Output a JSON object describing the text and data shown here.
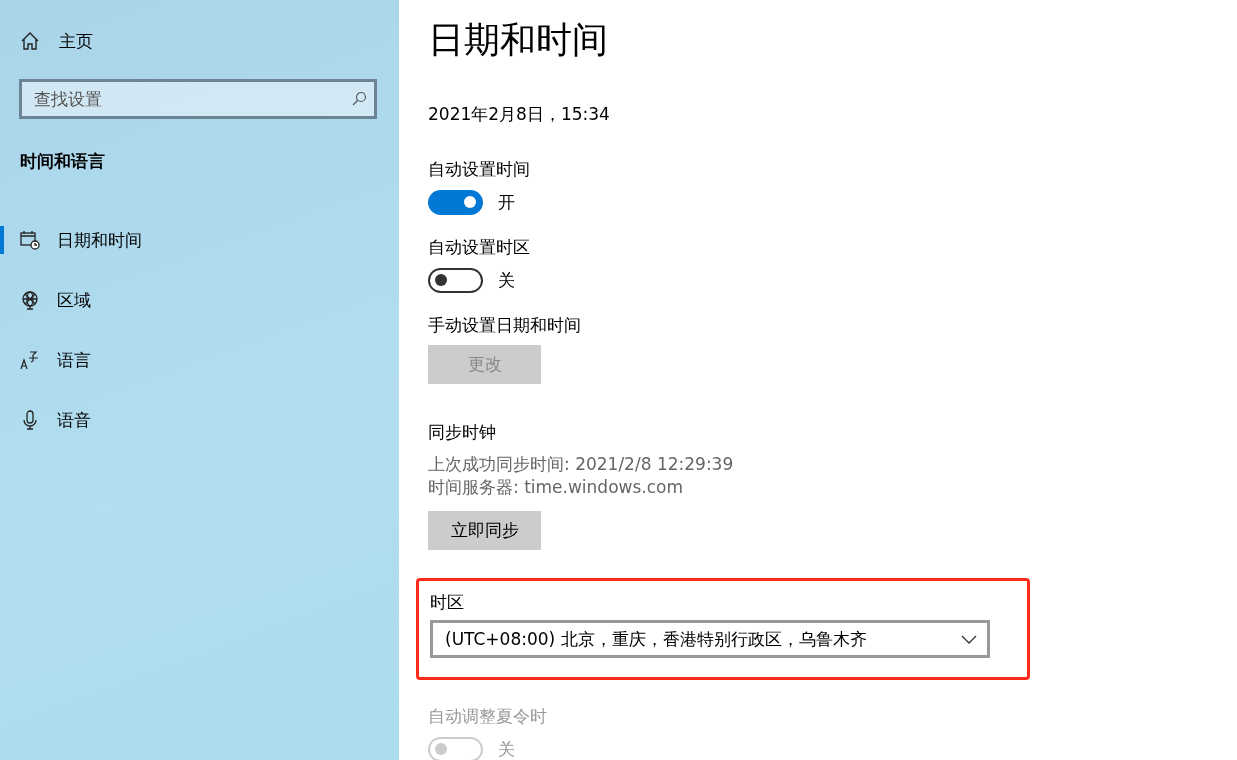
{
  "sidebar": {
    "home": {
      "label": "主页"
    },
    "search": {
      "placeholder": "查找设置"
    },
    "section_title": "时间和语言",
    "items": [
      {
        "label": "日期和时间",
        "selected": true
      },
      {
        "label": "区域",
        "selected": false
      },
      {
        "label": "语言",
        "selected": false
      },
      {
        "label": "语音",
        "selected": false
      }
    ]
  },
  "page": {
    "title": "日期和时间",
    "current_datetime": "2021年2月8日，15:34",
    "settings": [
      {
        "kind": "toggle",
        "label": "自动设置时间",
        "on": true,
        "state_text": "开",
        "disabled": false
      },
      {
        "kind": "toggle",
        "label": "自动设置时区",
        "on": false,
        "state_text": "关",
        "disabled": false
      },
      {
        "kind": "button",
        "label": "手动设置日期和时间",
        "button": "更改",
        "disabled": true
      },
      {
        "kind": "sync",
        "label": "同步时钟",
        "lines": [
          "上次成功同步时间: 2021/2/8 12:29:39",
          "时间服务器: time.windows.com"
        ],
        "button": "立即同步",
        "disabled": false
      },
      {
        "kind": "dropdown",
        "label": "时区",
        "value": "(UTC+08:00) 北京，重庆，香港特别行政区，乌鲁木齐",
        "highlighted": true
      },
      {
        "kind": "toggle",
        "label": "自动调整夏令时",
        "on": false,
        "state_text": "关",
        "disabled": true
      }
    ]
  }
}
